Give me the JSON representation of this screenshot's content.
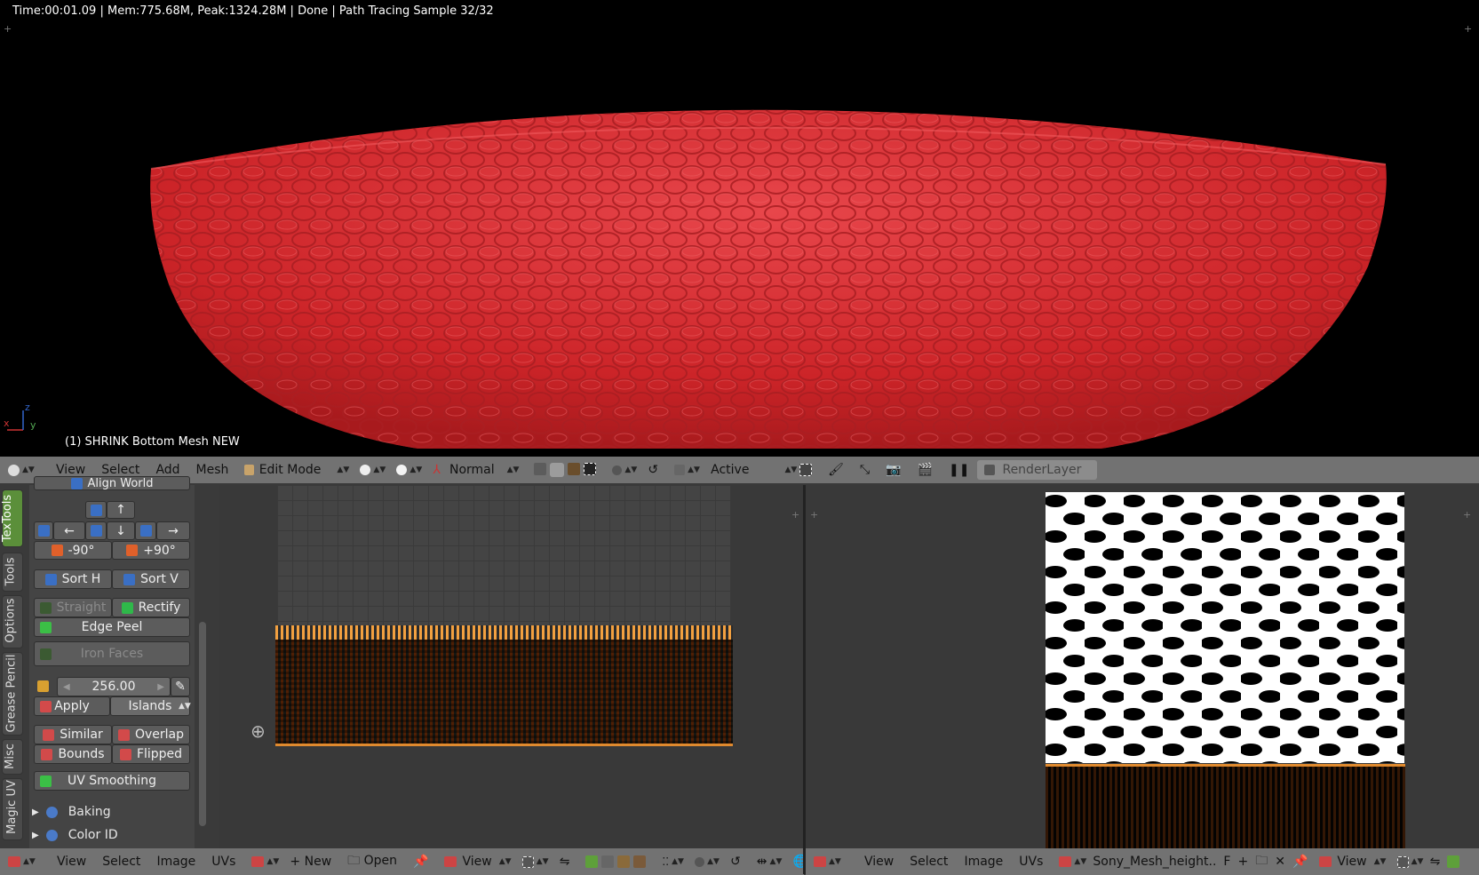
{
  "viewport": {
    "render_status": "Time:00:01.09 | Mem:775.68M, Peak:1324.28M | Done | Path Tracing Sample 32/32",
    "object_label": "(1) SHRINK Bottom Mesh NEW",
    "axis_x": "x",
    "axis_y": "y",
    "axis_z": "z"
  },
  "viewport_header": {
    "view": "View",
    "select": "Select",
    "add": "Add",
    "mesh": "Mesh",
    "mode": "Edit Mode",
    "orientation": "Normal",
    "pivot": "Active",
    "render_layer": "RenderLayer"
  },
  "tool_panel": {
    "tabs": [
      "TexTools",
      "Tools",
      "Options",
      "Grease Pencil",
      "Misc",
      "Magic UV"
    ],
    "align_world": "Align World",
    "arrow_up": "↑",
    "arrow_left": "←",
    "arrow_down": "↓",
    "arrow_right": "→",
    "rotate_neg": "-90°",
    "rotate_pos": "+90°",
    "sort_h": "Sort H",
    "sort_v": "Sort V",
    "straight": "Straight",
    "rectify": "Rectify",
    "edge_peel": "Edge Peel",
    "iron_faces": "Iron Faces",
    "texel_value": "256.00",
    "apply": "Apply",
    "islands": "Islands",
    "similar": "Similar",
    "overlap": "Overlap",
    "bounds": "Bounds",
    "flipped": "Flipped",
    "uv_smoothing": "UV Smoothing",
    "baking": "Baking",
    "color_id": "Color ID"
  },
  "uv_header": {
    "view": "View",
    "select": "Select",
    "image": "Image",
    "uvs": "UVs",
    "new": "New",
    "open": "Open",
    "view2": "View"
  },
  "image_header": {
    "view": "View",
    "select": "Select",
    "image": "Image",
    "uvs": "UVs",
    "image_name": "Sony_Mesh_height..",
    "fake_user": "F",
    "view2": "View"
  },
  "colors": {
    "bowl_red": "#d42a2e",
    "header_gray": "#727272",
    "uv_orange": "#e08a2e",
    "uv_blue": "#3d5fa8",
    "tab_active_green": "#5b8f3a"
  }
}
